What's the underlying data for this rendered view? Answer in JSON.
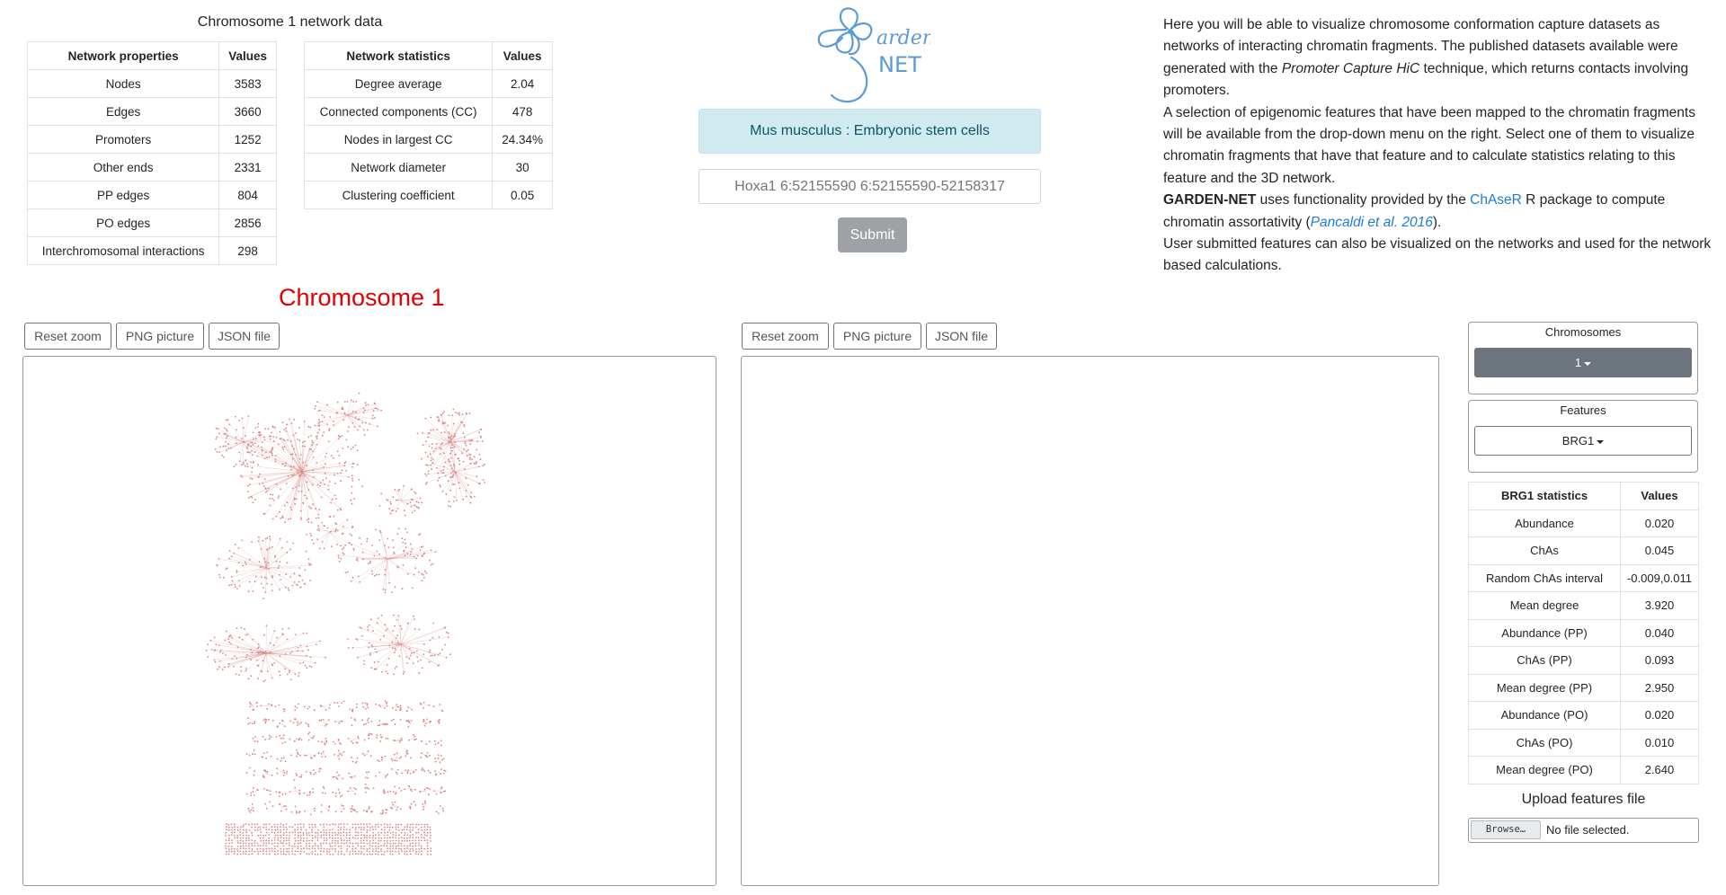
{
  "network_data": {
    "title": "Chromosome 1 network data",
    "properties": {
      "header": [
        "Network properties",
        "Values"
      ],
      "rows": [
        [
          "Nodes",
          "3583"
        ],
        [
          "Edges",
          "3660"
        ],
        [
          "Promoters",
          "1252"
        ],
        [
          "Other ends",
          "2331"
        ],
        [
          "PP edges",
          "804"
        ],
        [
          "PO edges",
          "2856"
        ],
        [
          "Interchromosomal interactions",
          "298"
        ]
      ]
    },
    "statistics": {
      "header": [
        "Network statistics",
        "Values"
      ],
      "rows": [
        [
          "Degree average",
          "2.04"
        ],
        [
          "Connected components (CC)",
          "478"
        ],
        [
          "Nodes in largest CC",
          "24.34%"
        ],
        [
          "Network diameter",
          "30"
        ],
        [
          "Clustering coefficient",
          "0.05"
        ]
      ]
    }
  },
  "logo": {
    "line1": "arden",
    "line2": "NET",
    "color": "#5b9bd5"
  },
  "dataset_banner": "Mus musculus : Embryonic stem cells",
  "search": {
    "placeholder": "Hoxa1 6:52155590 6:52155590-52158317"
  },
  "submit_label": "Submit",
  "description": {
    "p1_a": "Here you will be able to visualize chromosome conformation capture datasets as networks of interacting chromatin fragments. The published datasets available were generated with the ",
    "p1_em": "Promoter Capture HiC",
    "p1_b": " technique, which returns contacts involving promoters.",
    "p2": "A selection of epigenomic features that have been mapped to the chromatin fragments will be available from the drop-down menu on the right. Select one of them to visualize chromatin fragments that have that feature and to calculate statistics relating to this feature and the 3D network.",
    "p3_strong": "GARDEN-NET",
    "p3_a": " uses functionality provided by the ",
    "p3_link": "ChAseR",
    "p3_b": " R package to compute chromatin assortativity (",
    "p3_cite": "Pancaldi et al. 2016",
    "p3_c": ").",
    "p4": "User submitted features can also be visualized on the networks and used for the network based calculations."
  },
  "chromosome_title": "Chromosome 1",
  "toolbar_left": {
    "reset": "Reset zoom",
    "png": "PNG picture",
    "json": "JSON file"
  },
  "toolbar_right": {
    "reset": "Reset zoom",
    "png": "PNG picture",
    "json": "JSON file"
  },
  "sidebar": {
    "chromosomes_label": "Chromosomes",
    "chromosome_value": "1",
    "features_label": "Features",
    "feature_value": "BRG1",
    "feature_stats": {
      "header": [
        "BRG1 statistics",
        "Values"
      ],
      "rows": [
        [
          "Abundance",
          "0.020"
        ],
        [
          "ChAs",
          "0.045"
        ],
        [
          "Random ChAs interval",
          "-0.009,0.011"
        ],
        [
          "Mean degree",
          "3.920"
        ],
        [
          "Abundance (PP)",
          "0.040"
        ],
        [
          "ChAs (PP)",
          "0.093"
        ],
        [
          "Mean degree (PP)",
          "2.950"
        ],
        [
          "Abundance (PO)",
          "0.020"
        ],
        [
          "ChAs (PO)",
          "0.010"
        ],
        [
          "Mean degree (PO)",
          "2.640"
        ]
      ]
    },
    "upload_label": "Upload features file",
    "browse_label": "Browse…",
    "file_status": "No file selected."
  },
  "colors": {
    "title_red": "#e00000",
    "banner_bg": "#d1ecf1",
    "banner_border": "#bee5eb",
    "banner_text": "#0c5460",
    "submit_bg": "#9ea2a6",
    "dropdown_dark": "#6c757d",
    "node_color": "#d98585"
  }
}
